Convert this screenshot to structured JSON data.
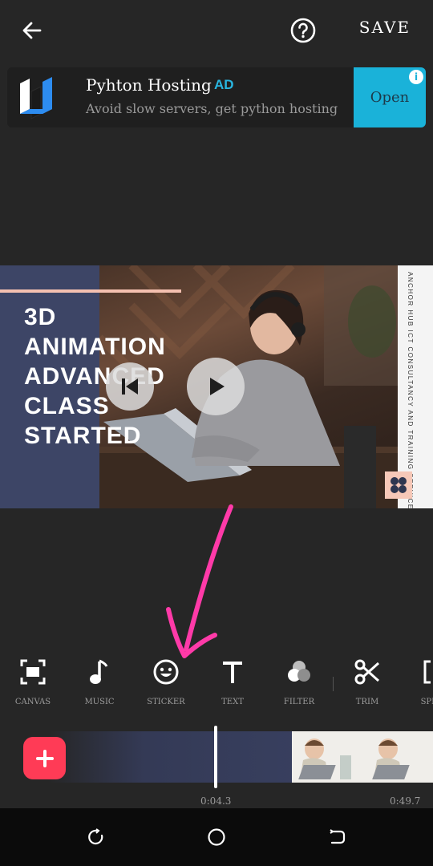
{
  "header": {
    "save_label": "SAVE"
  },
  "ad": {
    "title": "Pyhton Hosting",
    "badge": "AD",
    "description": "Avoid slow servers, get python hosting",
    "cta": "Open"
  },
  "preview": {
    "headline": [
      "3D",
      "ANIMATION",
      "ADVANCED",
      "CLASS",
      "STARTED"
    ],
    "side_text": "ANCHOR HUB ICT CONSULTANCY AND TRAINING SERVICES."
  },
  "tools": [
    {
      "label": "CANVAS",
      "icon": "canvas-icon"
    },
    {
      "label": "MUSIC",
      "icon": "music-note-icon"
    },
    {
      "label": "STICKER",
      "icon": "smiley-icon"
    },
    {
      "label": "TEXT",
      "icon": "text-icon"
    },
    {
      "label": "FILTER",
      "icon": "filter-icon"
    },
    {
      "label": "TRIM",
      "icon": "scissors-icon"
    },
    {
      "label": "SPLIT",
      "icon": "split-icon"
    }
  ],
  "timeline": {
    "current_time": "0:04.3",
    "total_time": "0:49.7"
  },
  "colors": {
    "accent": "#ff3b56",
    "annotation": "#ff3aa8",
    "ad_cta": "#1ab2d9",
    "background": "#262626"
  }
}
